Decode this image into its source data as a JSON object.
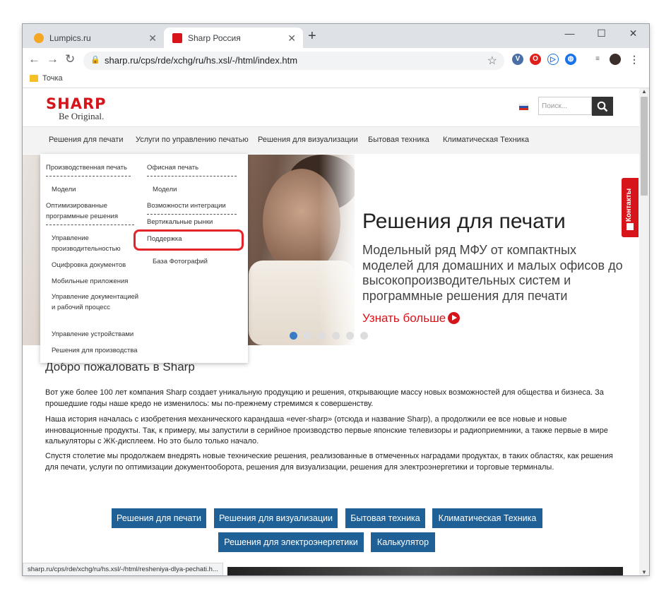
{
  "browser": {
    "tabs": [
      {
        "title": "Lumpics.ru",
        "active": false,
        "favicon_color": "#f5a623"
      },
      {
        "title": "Sharp Россия",
        "active": true,
        "favicon_color": "#d7141a"
      }
    ],
    "new_tab": "+",
    "window_controls": {
      "minimize": "—",
      "maximize": "☐",
      "close": "✕"
    },
    "url": "sharp.ru/cps/rde/xchg/ru/hs.xsl/-/html/index.htm",
    "bookmark_folder": "Точка",
    "status_url": "sharp.ru/cps/rde/xchg/ru/hs.xsl/-/html/resheniya-dlya-pechati.h..."
  },
  "site": {
    "logo": {
      "brand": "SHARP",
      "tagline": "Be Original."
    },
    "search_placeholder": "Поиск...",
    "nav": [
      "Решения для печати",
      "Услуги по управлению печатью",
      "Решения для визуализации",
      "Бытовая техника",
      "Климатическая Техника"
    ],
    "dropdown": {
      "col1": {
        "heading": "Производственная печать",
        "items": [
          "Модели",
          "Оптимизированные программные решения",
          "Управление производительностью",
          "Оцифровка документов",
          "Мобильные приложения",
          "Управление документацией и рабочий процесс",
          "Управление устройствами",
          "Решения для производства"
        ]
      },
      "col2": {
        "heading": "Офисная печать",
        "items": [
          "Модели",
          "Возможности интеграции",
          "Вертикальные рынки",
          "Поддержка",
          "База Фотографий"
        ]
      }
    },
    "hero": {
      "title": "Решения для печати",
      "subtitle": "Модельный ряд МФУ от компактных моделей для домашних и малых офисов до высокопроизводительных систем и программные решения для печати",
      "more": "Узнать больше",
      "slides": 6,
      "active_slide": 1
    },
    "contacts_tab": "Контакты",
    "welcome": "Добро пожаловать в Sharp",
    "paragraphs": [
      "Вот уже более 100 лет компания Sharp создает уникальную продукцию и решения, открывающие массу новых возможностей для общества и бизнеса. За прошедшие годы наше кредо не изменилось: мы по-прежнему стремимся к совершенству.",
      "Наша история началась с изобретения механического карандаша «ever-sharp» (отсюда и название Sharp), а продолжили ее все новые и новые инновационные продукты. Так, к примеру, мы запустили в серийное производство первые японские телевизоры и радиоприемники, а также первые в мире калькуляторы с ЖК-дисплеем. Но это было только начало.",
      "Спустя столетие мы продолжаем внедрять новые технические решения, реализованные в отмеченных наградами продуктах, в таких областях, как решения для печати, услуги по оптимизации документооборота, решения для визуализации, решения для электроэнергетики и торговые терминалы."
    ],
    "category_buttons": [
      "Решения для печати",
      "Решения для визуализации",
      "Бытовая техника",
      "Климатическая Техника",
      "Решения для электроэнергетики",
      "Калькулятор"
    ],
    "colors": {
      "brand_red": "#d7141a",
      "button_blue": "#1f6196",
      "highlight_red": "#e2242a"
    }
  }
}
